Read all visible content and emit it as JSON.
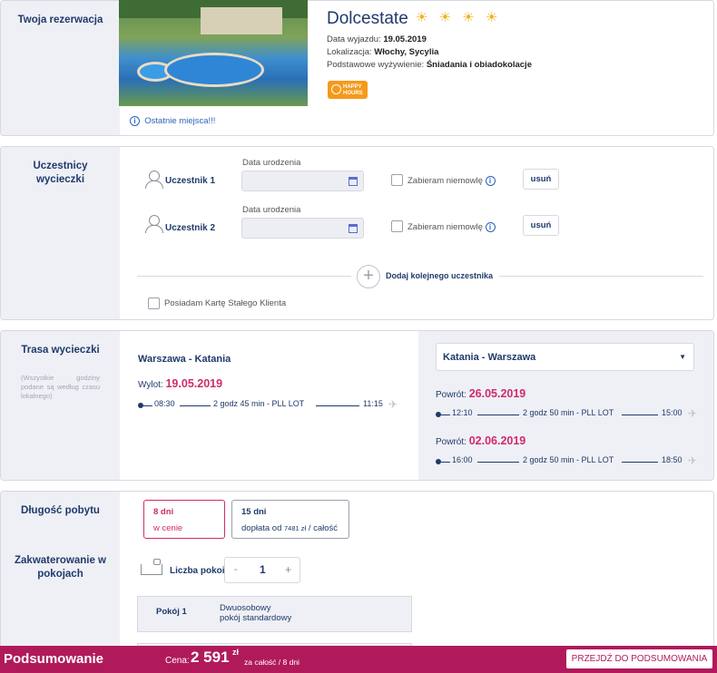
{
  "reservation": {
    "title": "Twoja rezerwacja",
    "hotel_name": "Dolcestate",
    "stars": "☀ ☀ ☀ ☀",
    "departure_label": "Data wyjazdu:",
    "departure_value": "19.05.2019",
    "location_label": "Lokalizacja:",
    "location_value": "Włochy, Sycylia",
    "board_label": "Podstawowe wyżywienie:",
    "board_value": "Śniadania i obiadokolacje",
    "badge_line1": "HAPPY",
    "badge_line2": "HOURS",
    "last_places": "Ostatnie miejsca!!!"
  },
  "participants": {
    "title": "Uczestnicy wycieczki",
    "items": [
      {
        "name": "Uczestnik 1",
        "date_label": "Data urodzenia",
        "infant_label": "Zabieram niemowlę",
        "remove_label": "usuń"
      },
      {
        "name": "Uczestnik 2",
        "date_label": "Data urodzenia",
        "infant_label": "Zabieram niemowlę",
        "remove_label": "usuń"
      }
    ],
    "add_label": "Dodaj kolejnego uczestnika",
    "loyalty_label": "Posiadam Kartę Stałego Klienta"
  },
  "route": {
    "title": "Trasa wycieczki",
    "note": "(Wszystkie godziny podane są według czasu lokalnego)",
    "outbound": {
      "title": "Warszawa - Katania",
      "date_label": "Wylot:",
      "date": "19.05.2019",
      "dep": "08:30",
      "info": "2 godz 45 min - PLL LOT",
      "arr": "11:15"
    },
    "return_select": "Katania - Warszawa",
    "returns": [
      {
        "date_label": "Powrót:",
        "date": "26.05.2019",
        "dep": "12:10",
        "info": "2 godz 50 min - PLL LOT",
        "arr": "15:00"
      },
      {
        "date_label": "Powrót:",
        "date": "02.06.2019",
        "dep": "16:00",
        "info": "2 godz 50 min - PLL LOT",
        "arr": "18:50"
      }
    ]
  },
  "stay": {
    "title": "Długość pobytu",
    "options": [
      {
        "days": "8 dni",
        "desc": "w cenie"
      },
      {
        "days": "15 dni",
        "desc_prefix": "dopłata od",
        "desc_amount": "7481 zł",
        "desc_suffix": "/ całość"
      }
    ],
    "accommodation_title": "Zakwaterowanie w pokojach",
    "rooms_label": "Liczba pokoi",
    "rooms_value": "1",
    "minus": "-",
    "plus": "+",
    "room": {
      "name": "Pokój 1",
      "type_line1": "Dwuosobowy",
      "type_line2": "pokój standardowy"
    }
  },
  "summary": {
    "label": "Podsumowanie",
    "price_label": "Cena:",
    "price": "2 591",
    "currency": "zł",
    "per": "za całość / 8 dni",
    "go_button": "PRZEJDŹ DO PODSUMOWANIA"
  }
}
